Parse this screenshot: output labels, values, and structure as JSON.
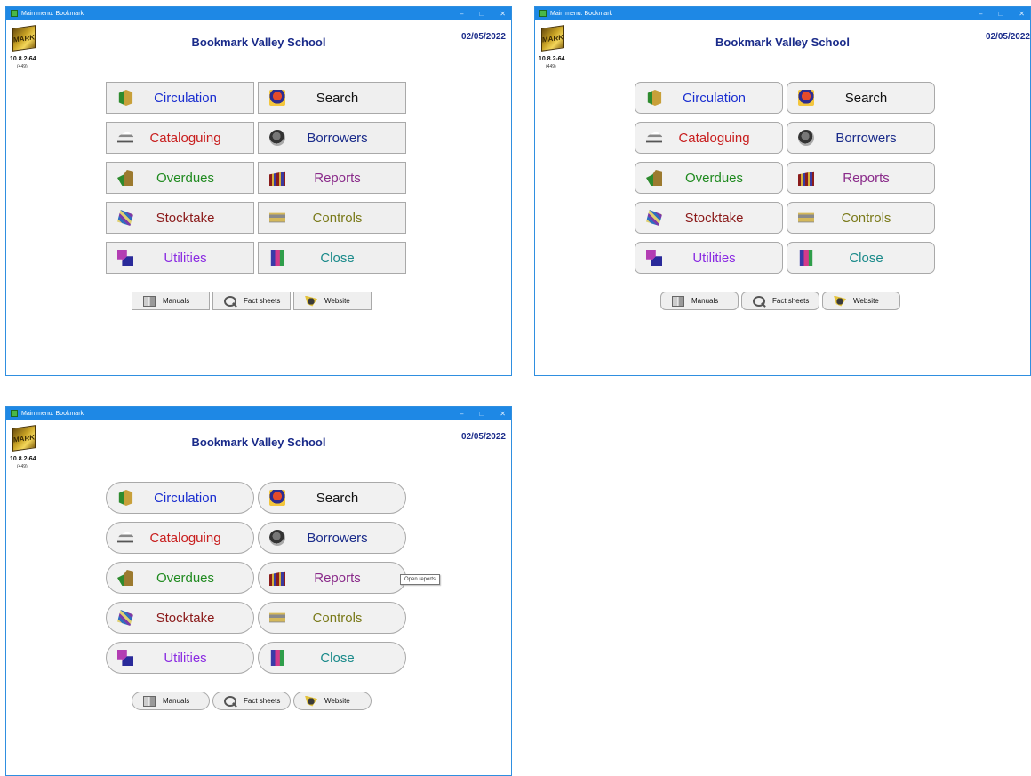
{
  "window": {
    "title": "Main menu: Bookmark",
    "logo_text": "MARK",
    "version": "10.8.2-64",
    "build": "(449)",
    "school_name": "Bookmark Valley School",
    "date": "02/05/2022"
  },
  "titlebar_controls": {
    "minimize": "–",
    "maximize": "□",
    "close": "✕"
  },
  "menu_buttons": [
    {
      "label": "Circulation",
      "color": "#1b2fd0",
      "icon": "circulation-icon"
    },
    {
      "label": "Search",
      "color": "#111111",
      "icon": "search-icon"
    },
    {
      "label": "Cataloguing",
      "color": "#c81e1e",
      "icon": "cataloguing-icon"
    },
    {
      "label": "Borrowers",
      "color": "#1a2b8a",
      "icon": "borrowers-icon"
    },
    {
      "label": "Overdues",
      "color": "#1f8a1f",
      "icon": "overdues-icon"
    },
    {
      "label": "Reports",
      "color": "#8a2b8a",
      "icon": "reports-icon"
    },
    {
      "label": "Stocktake",
      "color": "#8b1a1a",
      "icon": "stocktake-icon"
    },
    {
      "label": "Controls",
      "color": "#7a7a1a",
      "icon": "controls-icon"
    },
    {
      "label": "Utilities",
      "color": "#8a2be2",
      "icon": "utilities-icon"
    },
    {
      "label": "Close",
      "color": "#1a8a8a",
      "icon": "close-door-icon"
    }
  ],
  "small_buttons": [
    {
      "label": "Manuals",
      "icon": "manuals-icon"
    },
    {
      "label": "Fact sheets",
      "icon": "magnifier-icon"
    },
    {
      "label": "Website",
      "icon": "website-icon"
    }
  ],
  "tooltip": "Open reports"
}
